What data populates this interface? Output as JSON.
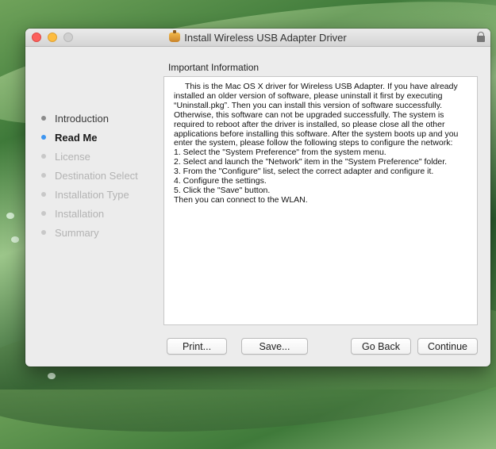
{
  "window": {
    "title": "Install Wireless USB Adapter Driver"
  },
  "sidebar": {
    "items": [
      {
        "label": "Introduction",
        "state": "done"
      },
      {
        "label": "Read Me",
        "state": "current"
      },
      {
        "label": "License",
        "state": "pending"
      },
      {
        "label": "Destination Select",
        "state": "pending"
      },
      {
        "label": "Installation Type",
        "state": "pending"
      },
      {
        "label": "Installation",
        "state": "pending"
      },
      {
        "label": "Summary",
        "state": "pending"
      }
    ]
  },
  "main": {
    "section_title": "Important Information",
    "intro": "This is the Mac OS X driver for Wireless USB Adapter. If you have already installed an older version of software, please uninstall it first by executing “Uninstall.pkg”. Then you can install this version of software successfully. Otherwise, this software can not be upgraded successfully. The system is required to reboot after the driver is installed, so please close all the other applications before installing this software. After the system boots up and you enter the system, please follow the following steps to configure the network:",
    "steps": [
      "1. Select the \"System Preference\" from the system menu.",
      "2. Select and launch the \"Network\" item in the \"System Preference\" folder.",
      "3. From the \"Configure\" list, select the correct adapter and configure it.",
      "4. Configure the settings.",
      "5. Click the \"Save\" button.",
      "Then you can connect to the WLAN."
    ]
  },
  "buttons": {
    "print": "Print...",
    "save": "Save...",
    "go_back": "Go Back",
    "continue": "Continue"
  },
  "colors": {
    "current_step": "#3d95f0",
    "close": "#fc605c",
    "minimize": "#fdbc40"
  }
}
